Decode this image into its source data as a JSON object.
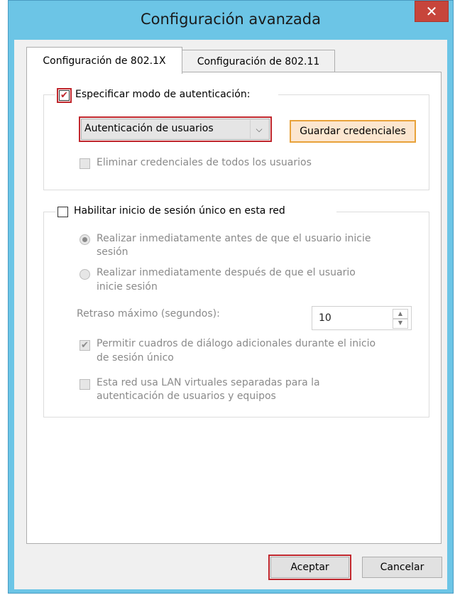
{
  "window": {
    "title": "Configuración avanzada",
    "close_glyph": "✕"
  },
  "tabs": [
    {
      "label": "Configuración de 802.1X"
    },
    {
      "label": "Configuración de 802.11"
    }
  ],
  "auth_group": {
    "specify_mode_label": "Especificar modo de autenticación:",
    "specify_mode_checked": true,
    "auth_mode_value": "Autenticación de usuarios",
    "save_credentials_label": "Guardar credenciales",
    "delete_credentials_label": "Eliminar credenciales de todos los usuarios"
  },
  "sso_group": {
    "enable_sso_label": "Habilitar inicio de sesión único en esta red",
    "before_logon_line1": "Realizar inmediatamente antes de que el usuario inicie",
    "before_logon_line2": "sesión",
    "after_logon_line1": "Realizar inmediatamente después de que el usuario",
    "after_logon_line2": "inicie sesión",
    "max_delay_label": "Retraso máximo (segundos):",
    "max_delay_value": "10",
    "allow_dialogs_line1": "Permitir cuadros de diálogo adicionales durante el inicio",
    "allow_dialogs_line2": "de sesión único",
    "vlan_line1": "Esta red usa LAN virtuales separadas para la",
    "vlan_line2": "autenticación de usuarios y equipos"
  },
  "footer": {
    "ok_label": "Aceptar",
    "cancel_label": "Cancelar"
  },
  "colors": {
    "accent_red": "#c0272d",
    "title_bar": "#6cc5e6",
    "close_red": "#c7453b"
  }
}
